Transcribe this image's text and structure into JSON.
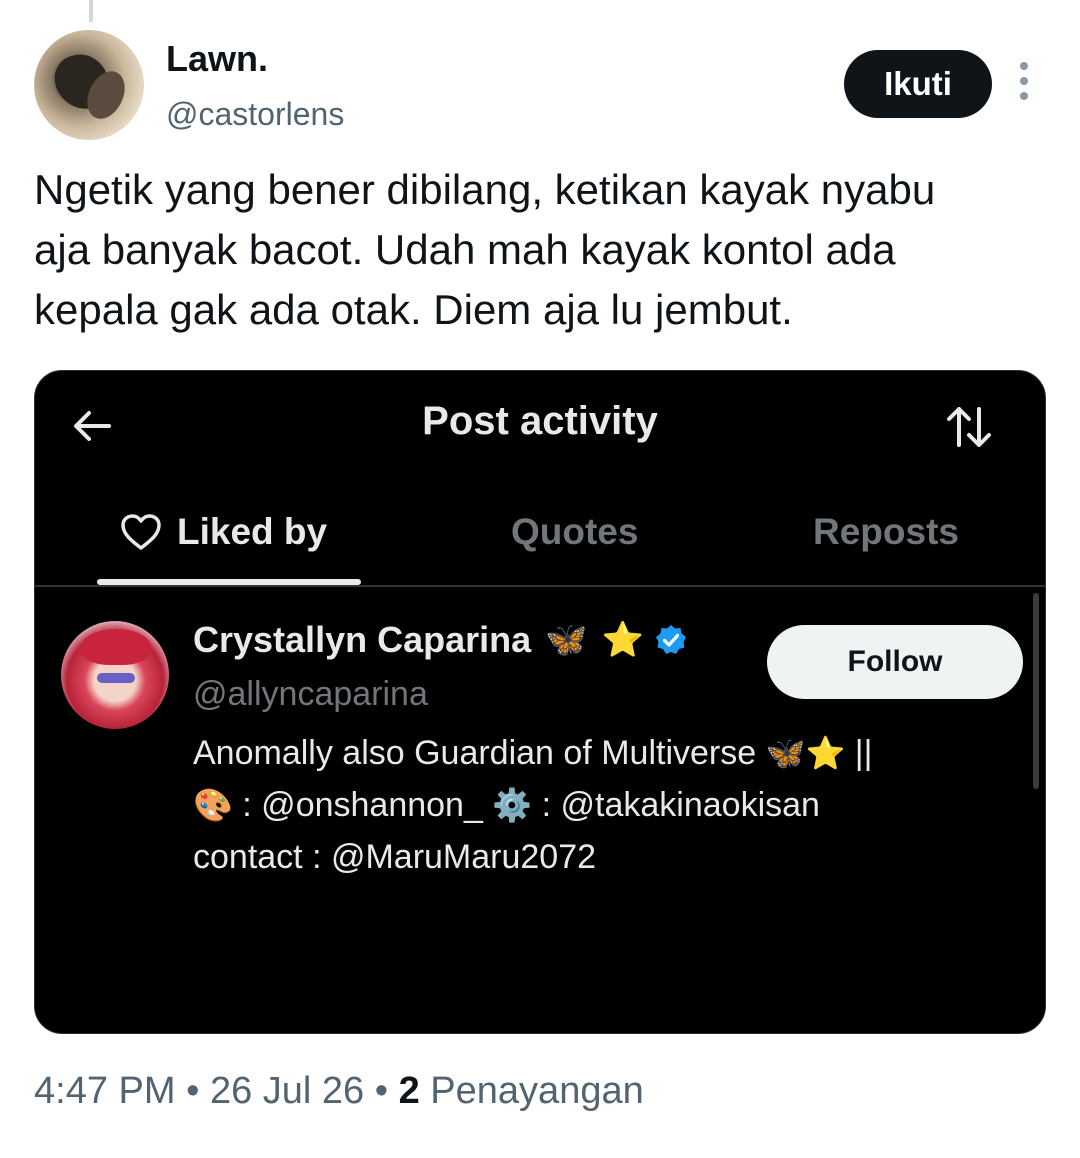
{
  "author": {
    "display_name": "Lawn.",
    "handle": "@castorlens",
    "follow_label": "Ikuti"
  },
  "tweet": {
    "lines": [
      "Ngetik yang bener dibilang, ketikan kayak nyabu",
      "aja banyak bacot. Udah mah kayak kontol ada",
      "kepala gak ada otak. Diem aja lu jembut."
    ]
  },
  "embedded_screenshot": {
    "title": "Post activity",
    "tabs": [
      {
        "label": "Liked by",
        "active": true
      },
      {
        "label": "Quotes",
        "active": false
      },
      {
        "label": "Reposts",
        "active": false
      }
    ],
    "user": {
      "name": "Crystallyn Caparina",
      "name_emojis": [
        "🦋",
        "⭐"
      ],
      "handle": "@allyncaparina",
      "follow_label": "Follow",
      "bio": {
        "line1_text": "Anomally also Guardian of Multiverse",
        "line1_emojis": "🦋⭐",
        "line1_end": "||",
        "line2_emoji1": "🎨",
        "line2_mid": " : @onshannon_ ",
        "line2_emoji2": "⚙️",
        "line2_end": " : @takakinaokisan",
        "line3": "contact : @MaruMaru2072"
      }
    }
  },
  "meta": {
    "time": "4:47 PM",
    "separator": " • ",
    "date": "26 Jul 26",
    "views_count": "2",
    "views_label": " Penayangan"
  },
  "colors": {
    "verified": "#1d9bf0",
    "muted": "#536471",
    "dark_bg": "#000000"
  }
}
